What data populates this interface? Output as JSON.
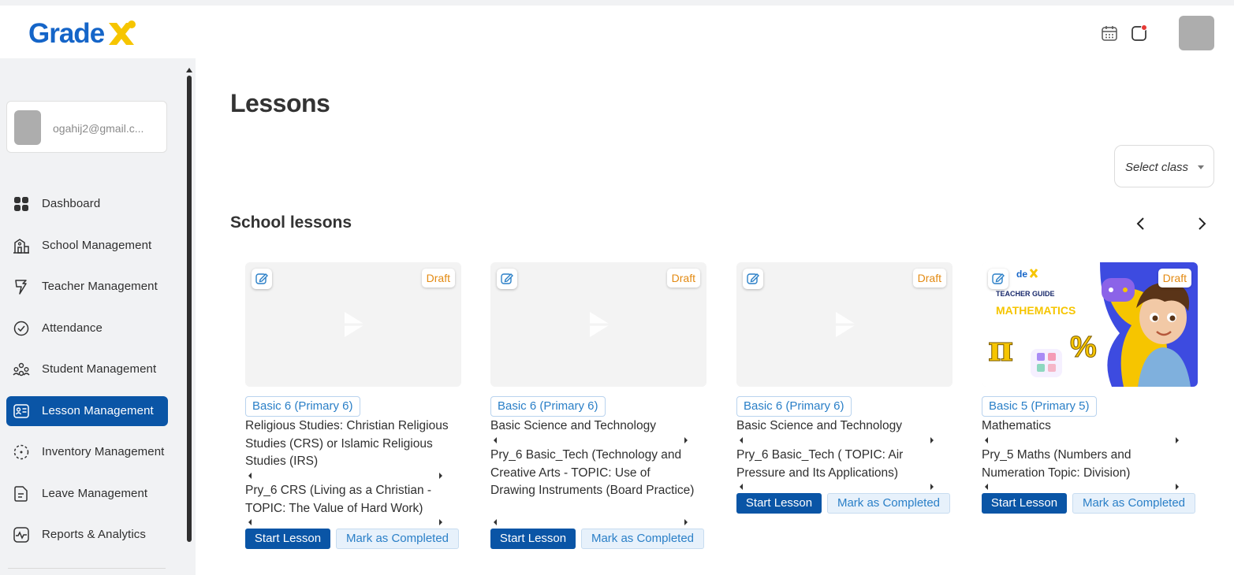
{
  "app": {
    "logo_text": "Grade"
  },
  "user": {
    "email": "ogahij2@gmail.c..."
  },
  "sidebar": {
    "items": [
      {
        "label": "Dashboard",
        "icon": "dashboard-icon"
      },
      {
        "label": "School Management",
        "icon": "school-icon"
      },
      {
        "label": "Teacher Management",
        "icon": "teacher-icon"
      },
      {
        "label": "Attendance",
        "icon": "check-circle-icon"
      },
      {
        "label": "Student Management",
        "icon": "students-icon"
      },
      {
        "label": "Lesson Management",
        "icon": "lesson-icon",
        "active": true
      },
      {
        "label": "Inventory Management",
        "icon": "inventory-icon"
      },
      {
        "label": "Leave Management",
        "icon": "leave-icon"
      },
      {
        "label": "Reports & Analytics",
        "icon": "reports-icon"
      }
    ]
  },
  "main": {
    "title": "Lessons",
    "select_class": "Select class",
    "section_title": "School lessons"
  },
  "lessons": [
    {
      "badge": "Draft",
      "class": "Basic 6 (Primary 6)",
      "subject": "Religious Studies: Christian Religious Studies (CRS) or Islamic Religious Studies (IRS)",
      "topic": "Pry_6 CRS (Living as a Christian - TOPIC: The Value of Hard Work)",
      "start_label": "Start Lesson",
      "complete_label": "Mark as Completed"
    },
    {
      "badge": "Draft",
      "class": "Basic 6 (Primary 6)",
      "subject": "Basic Science and Technology",
      "topic": "Pry_6 Basic_Tech (Technology and Creative Arts - TOPIC: Use of Drawing Instruments (Board Practice)",
      "start_label": "Start Lesson",
      "complete_label": "Mark as Completed"
    },
    {
      "badge": "Draft",
      "class": "Basic 6 (Primary 6)",
      "subject": "Basic Science and Technology",
      "topic": "Pry_6 Basic_Tech ( TOPIC: Air Pressure and Its Applications)",
      "start_label": "Start Lesson",
      "complete_label": "Mark as Completed"
    },
    {
      "badge": "Draft",
      "class": "Basic 5 (Primary 5)",
      "subject": "Mathematics",
      "topic": "Pry_5 Maths (Numbers and Numeration Topic: Division)",
      "start_label": "Start Lesson",
      "complete_label": "Mark as Completed",
      "thumb": {
        "logo": "de",
        "guide": "TEACHER GUIDE",
        "subject": "MATHEMATICS",
        "pi": "π",
        "percent": "%"
      }
    }
  ],
  "colors": {
    "primary": "#0a55a6",
    "draft": "#e38a12",
    "tag": "#2a7fc7",
    "logo_blue": "#1565c8",
    "logo_yellow": "#f6c500"
  }
}
